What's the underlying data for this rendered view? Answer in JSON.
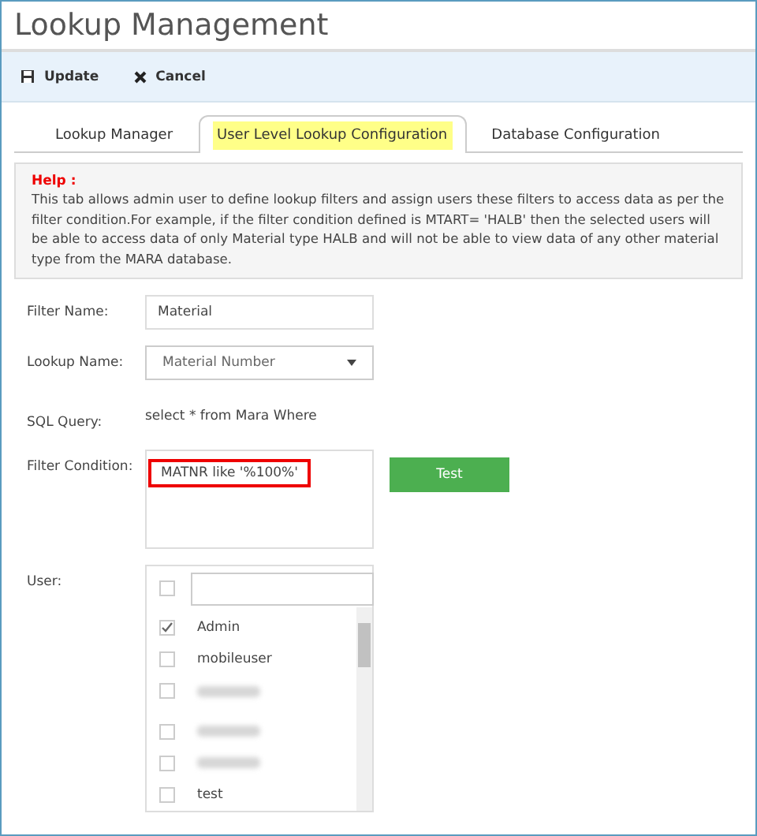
{
  "window": {
    "title": "Lookup Management"
  },
  "toolbar": [
    {
      "kind": "save",
      "label": "Update"
    },
    {
      "kind": "cancel",
      "label": "Cancel"
    }
  ],
  "tabs": [
    {
      "label": "Lookup Manager",
      "selected": false
    },
    {
      "label": "User Level Lookup Configuration",
      "selected": true
    },
    {
      "label": "Database Configuration",
      "selected": false
    }
  ],
  "help": {
    "title": "Help :",
    "text": "This tab allows admin user to define lookup filters and assign users these filters to access data as per the filter condition.For example, if the filter condition defined is MTART= 'HALB' then the selected users will be able to access data of only Material type HALB and will not be able to view data of any other material type from the MARA database."
  },
  "form": {
    "filter_name": {
      "label": "Filter Name:",
      "value": "Material"
    },
    "lookup_name": {
      "label": "Lookup Name:",
      "value": "Material Number"
    },
    "sql_query": {
      "label": "SQL Query:",
      "value": "select * from Mara Where"
    },
    "filter_condition": {
      "label": "Filter Condition:",
      "value": "MATNR like '%100%'",
      "button": "Test"
    },
    "user": {
      "label": "User:",
      "select_all_checked": false,
      "users": [
        {
          "kind": "name",
          "name": "Admin",
          "checked": true
        },
        {
          "kind": "name",
          "name": "mobileuser",
          "checked": false
        },
        {
          "kind": "redacted",
          "checked": false
        },
        {
          "kind": "redacted",
          "checked": false
        },
        {
          "kind": "redacted",
          "checked": false
        },
        {
          "kind": "name",
          "name": "test",
          "checked": false
        }
      ]
    }
  }
}
